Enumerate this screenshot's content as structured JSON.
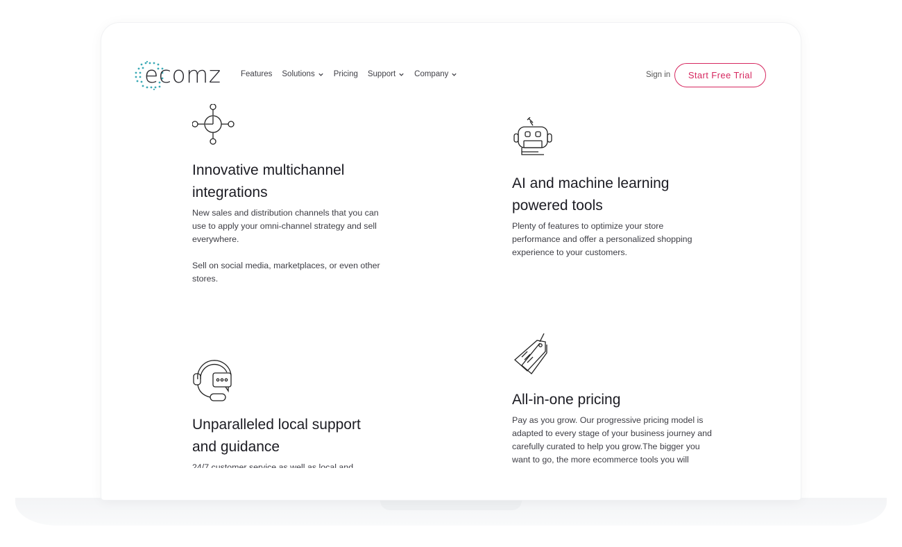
{
  "brand": {
    "name": "ecomz",
    "accent": "#d6275f",
    "logo_dot_color": "#3aa9b5"
  },
  "nav": {
    "items": [
      {
        "label": "Features",
        "dropdown": false
      },
      {
        "label": "Solutions",
        "dropdown": true
      },
      {
        "label": "Pricing",
        "dropdown": false
      },
      {
        "label": "Support",
        "dropdown": true
      },
      {
        "label": "Company",
        "dropdown": true
      }
    ],
    "signin": "Sign in",
    "cta": "Start Free Trial"
  },
  "features": [
    {
      "icon": "multichannel-network-icon",
      "title_line1": "Innovative multichannel",
      "title_line2": "integrations",
      "paragraphs": [
        "New sales and distribution channels that you can use to apply your omni-channel strategy and sell everywhere.",
        "Sell on social media, marketplaces, or even other stores."
      ]
    },
    {
      "icon": "robot-icon",
      "title_line1": "AI and machine learning",
      "title_line2": "powered tools",
      "paragraphs": [
        "Plenty of features to optimize your store performance and offer a personalized shopping experience to your customers."
      ]
    },
    {
      "icon": "support-headset-icon",
      "title_line1": "Unparalleled local support",
      "title_line2": "and guidance",
      "paragraphs": [
        "24/7 customer service as well as local and"
      ]
    },
    {
      "icon": "price-tag-icon",
      "title_line1": "All-in-one pricing",
      "title_line2": "",
      "paragraphs": [
        "Pay as you grow. Our progressive pricing model is adapted to every stage of your business journey and carefully curated to help you grow.The bigger you want to go, the more ecommerce tools you will"
      ]
    }
  ]
}
